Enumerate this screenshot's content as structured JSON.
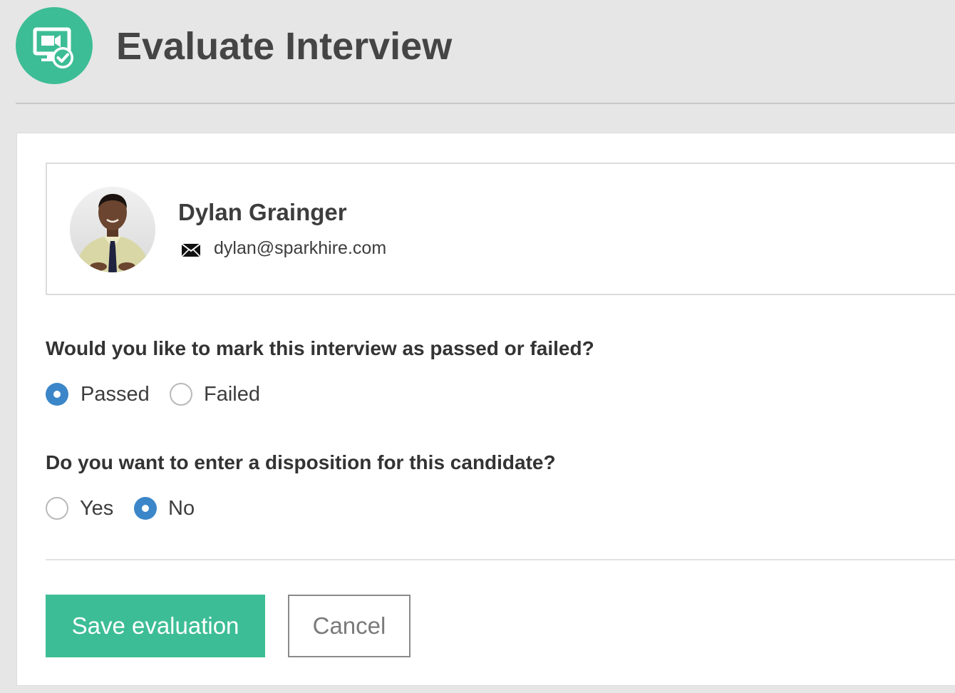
{
  "header": {
    "title": "Evaluate Interview",
    "icon": "video-check-icon",
    "icon_color": "#3dbd95"
  },
  "candidate": {
    "name": "Dylan Grainger",
    "email": "dylan@sparkhire.com",
    "email_icon": "envelope-icon"
  },
  "pass_fail": {
    "question": "Would you like to mark this interview as passed or failed?",
    "options": [
      {
        "label": "Passed",
        "selected": true
      },
      {
        "label": "Failed",
        "selected": false
      }
    ]
  },
  "disposition": {
    "question": "Do you want to enter a disposition for this candidate?",
    "options": [
      {
        "label": "Yes",
        "selected": false
      },
      {
        "label": "No",
        "selected": true
      }
    ]
  },
  "actions": {
    "save_label": "Save evaluation",
    "cancel_label": "Cancel"
  },
  "colors": {
    "accent": "#3dbd95",
    "radio_selected": "#3b86c8"
  }
}
